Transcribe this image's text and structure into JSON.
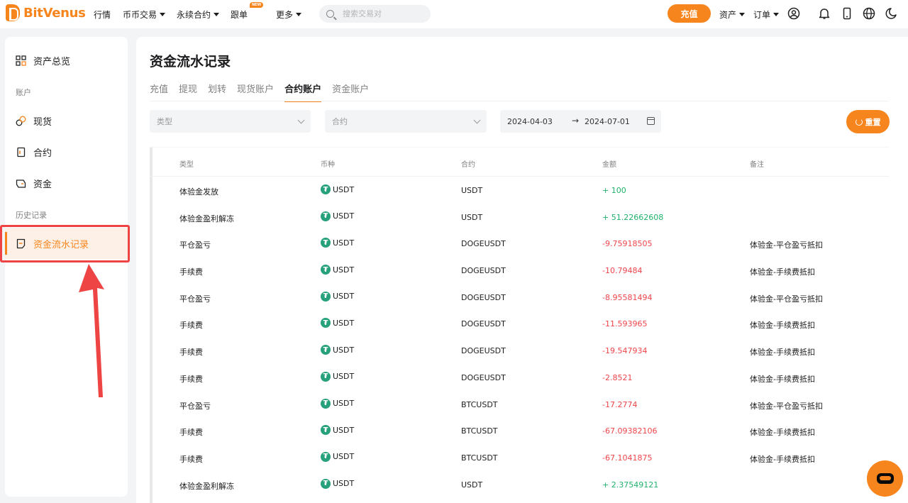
{
  "brand": {
    "name": "BitVenus",
    "color": "#f7851d"
  },
  "nav": {
    "market": "行情",
    "spot": "币币交易",
    "futures": "永续合约",
    "copy": "跟单",
    "copy_badge": "NEW",
    "more": "更多",
    "search_placeholder": "搜索交易对",
    "deposit": "充值",
    "assets": "资产",
    "orders": "订单"
  },
  "sidebar": {
    "overview": "资产总览",
    "section_account": "账户",
    "spot": "现货",
    "contract": "合约",
    "funding": "资金",
    "section_history": "历史记录",
    "ledger": "资金流水记录"
  },
  "main": {
    "title": "资金流水记录",
    "tabs": [
      "充值",
      "提现",
      "划转",
      "现货账户",
      "合约账户",
      "资金账户"
    ],
    "active_tab": 4,
    "filters": {
      "type_placeholder": "类型",
      "contract_placeholder": "合约",
      "date_start": "2024-04-03",
      "date_end": "2024-07-01",
      "reset": "重置"
    },
    "table": {
      "headers": [
        "类型",
        "币种",
        "合约",
        "金额",
        "备注"
      ],
      "rows": [
        {
          "type": "体验金发放",
          "coin": "USDT",
          "contract": "USDT",
          "amount": "+ 100",
          "sign": "pos",
          "note": ""
        },
        {
          "type": "体验金盈利解冻",
          "coin": "USDT",
          "contract": "USDT",
          "amount": "+ 51.22662608",
          "sign": "pos",
          "note": ""
        },
        {
          "type": "平仓盈亏",
          "coin": "USDT",
          "contract": "DOGEUSDT",
          "amount": "-9.75918505",
          "sign": "neg",
          "note": "体验金-平仓盈亏抵扣"
        },
        {
          "type": "手续费",
          "coin": "USDT",
          "contract": "DOGEUSDT",
          "amount": "-10.79484",
          "sign": "neg",
          "note": "体验金-手续费抵扣"
        },
        {
          "type": "平仓盈亏",
          "coin": "USDT",
          "contract": "DOGEUSDT",
          "amount": "-8.95581494",
          "sign": "neg",
          "note": "体验金-平仓盈亏抵扣"
        },
        {
          "type": "手续费",
          "coin": "USDT",
          "contract": "DOGEUSDT",
          "amount": "-11.593965",
          "sign": "neg",
          "note": "体验金-手续费抵扣"
        },
        {
          "type": "手续费",
          "coin": "USDT",
          "contract": "DOGEUSDT",
          "amount": "-19.547934",
          "sign": "neg",
          "note": "体验金-手续费抵扣"
        },
        {
          "type": "手续费",
          "coin": "USDT",
          "contract": "DOGEUSDT",
          "amount": "-2.8521",
          "sign": "neg",
          "note": "体验金-手续费抵扣"
        },
        {
          "type": "平仓盈亏",
          "coin": "USDT",
          "contract": "BTCUSDT",
          "amount": "-17.2774",
          "sign": "neg",
          "note": "体验金-平仓盈亏抵扣"
        },
        {
          "type": "手续费",
          "coin": "USDT",
          "contract": "BTCUSDT",
          "amount": "-67.09382106",
          "sign": "neg",
          "note": "体验金-手续费抵扣"
        },
        {
          "type": "手续费",
          "coin": "USDT",
          "contract": "BTCUSDT",
          "amount": "-67.1041875",
          "sign": "neg",
          "note": "体验金-手续费抵扣"
        },
        {
          "type": "体验金盈利解冻",
          "coin": "USDT",
          "contract": "USDT",
          "amount": "+ 2.37549121",
          "sign": "pos",
          "note": ""
        }
      ]
    }
  },
  "colors": {
    "accent": "#f7851d",
    "positive": "#20b26c",
    "negative": "#ef454a",
    "annotation": "#ef4444"
  }
}
